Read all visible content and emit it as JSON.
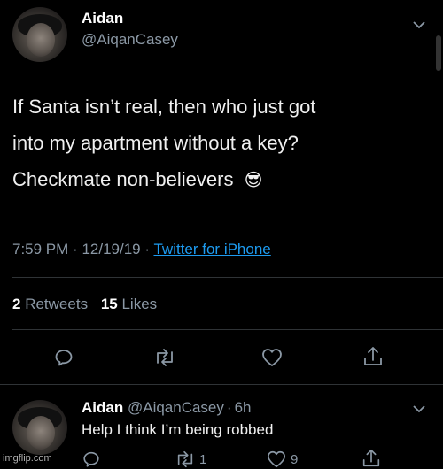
{
  "tweet": {
    "display_name": "Aidan",
    "handle": "@AiqanCasey",
    "text_lines": [
      "If Santa isn’t real, then who just got",
      "into my apartment without a key?",
      "Checkmate non-believers"
    ],
    "emoji": "😎",
    "time": "7:59 PM",
    "date": "12/19/19",
    "dot": "·",
    "source": "Twitter for iPhone",
    "retweets_count": "2",
    "retweets_label": "Retweets",
    "likes_count": "15",
    "likes_label": "Likes"
  },
  "reply": {
    "display_name": "Aidan",
    "handle": "@AiqanCasey",
    "dot": "·",
    "age": "6h",
    "text": "Help I think I’m being robbed",
    "retweet_count": "1",
    "like_count": "9"
  },
  "watermark": "imgflip.com",
  "colors": {
    "background": "#000000",
    "link": "#1d9bf0",
    "muted": "#8b98a5",
    "divider": "#2f3336"
  }
}
